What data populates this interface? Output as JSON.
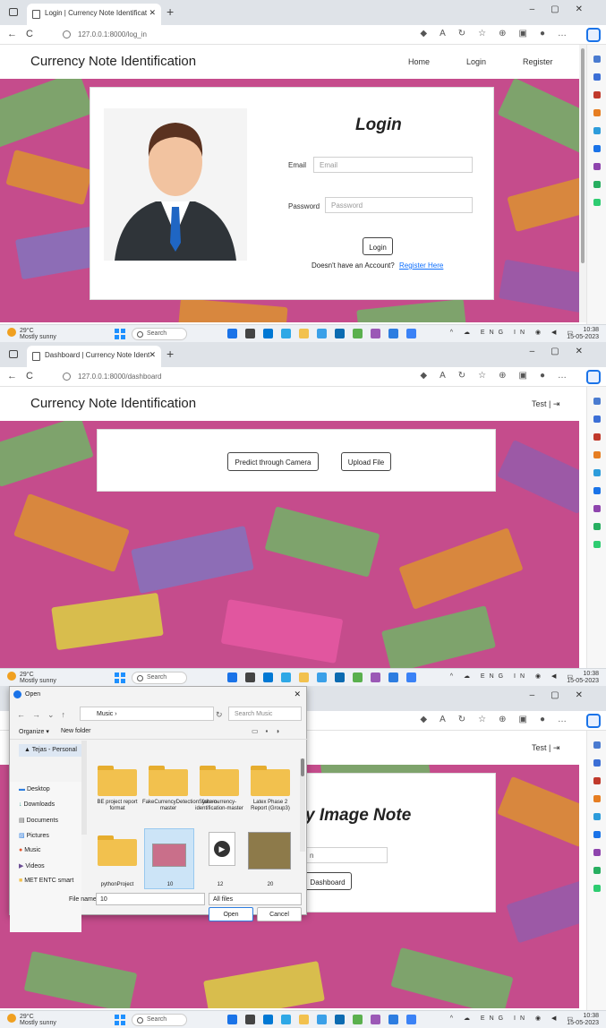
{
  "shot1": {
    "tab_title": "Login | Currency Note Identificat",
    "url": "127.0.0.1:8000/log_in",
    "brand": "Currency Note Identification",
    "nav": {
      "home": "Home",
      "login": "Login",
      "register": "Register"
    },
    "heading": "Login",
    "email_label": "Email",
    "email_placeholder": "Email",
    "password_label": "Password",
    "password_placeholder": "Password",
    "login_button": "Login",
    "account_text": "Doesn't have an Account?",
    "register_link": "Register Here"
  },
  "shot2": {
    "tab_title": "Dashboard | Currency Note Ident",
    "url": "127.0.0.1:8000/dashboard",
    "brand": "Currency Note Identification",
    "user": "Test |",
    "predict_button": "Predict through Camera",
    "upload_button": "Upload File"
  },
  "shot3": {
    "user": "Test |",
    "heading_partial": "y Image Note",
    "input_partial": "n",
    "dashboard_button": "Dashboard",
    "dialog": {
      "title": "Open",
      "breadcrumb": "Music",
      "search_placeholder": "Search Music",
      "organize": "Organize",
      "new_folder": "New folder",
      "quick_access": "Tejas - Personal",
      "sidebar": [
        "Desktop",
        "Downloads",
        "Documents",
        "Pictures",
        "Music",
        "Videos",
        "MET ENTC smart"
      ],
      "items": [
        {
          "label": "BE project report format",
          "kind": "folder"
        },
        {
          "label": "FakeCurrencyDetectionSystem-master",
          "kind": "folder"
        },
        {
          "label": "fake-currency-identification-master",
          "kind": "folder"
        },
        {
          "label": "Latex Phase 2 Report (Group3)",
          "kind": "folder"
        },
        {
          "label": "pythonProject",
          "kind": "folder"
        },
        {
          "label": "10",
          "kind": "image"
        },
        {
          "label": "12",
          "kind": "video"
        },
        {
          "label": "20",
          "kind": "image"
        }
      ],
      "filename_label": "File name:",
      "filename_value": "10",
      "filter": "All files",
      "open_button": "Open",
      "cancel_button": "Cancel"
    }
  },
  "taskbar": {
    "temp": "29°C",
    "weather": "Mostly sunny",
    "search": "Search",
    "lang": "ENG IN",
    "time": "10:38",
    "date": "15-05-2023"
  },
  "colors": {
    "accent": "#1a73e8",
    "link": "#0d6efd",
    "notes_pink": "#c54c8c",
    "notes_green": "#7aa86a",
    "notes_orange": "#d98a3a"
  }
}
